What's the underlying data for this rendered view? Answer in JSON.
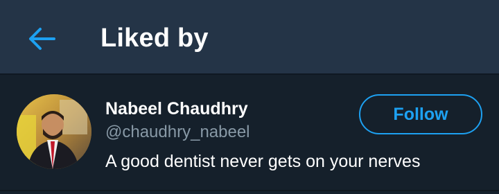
{
  "header": {
    "title": "Liked by",
    "back_icon": "arrow-left-icon",
    "accent_color": "#1da1f2"
  },
  "users": [
    {
      "name": "Nabeel Chaudhry",
      "handle": "@chaudhry_nabeel",
      "bio": "A good dentist never gets on your nerves",
      "follow_label": "Follow"
    }
  ],
  "colors": {
    "background": "#15202b",
    "header_background": "#243447",
    "secondary_text": "#8899a6",
    "accent": "#1da1f2"
  }
}
